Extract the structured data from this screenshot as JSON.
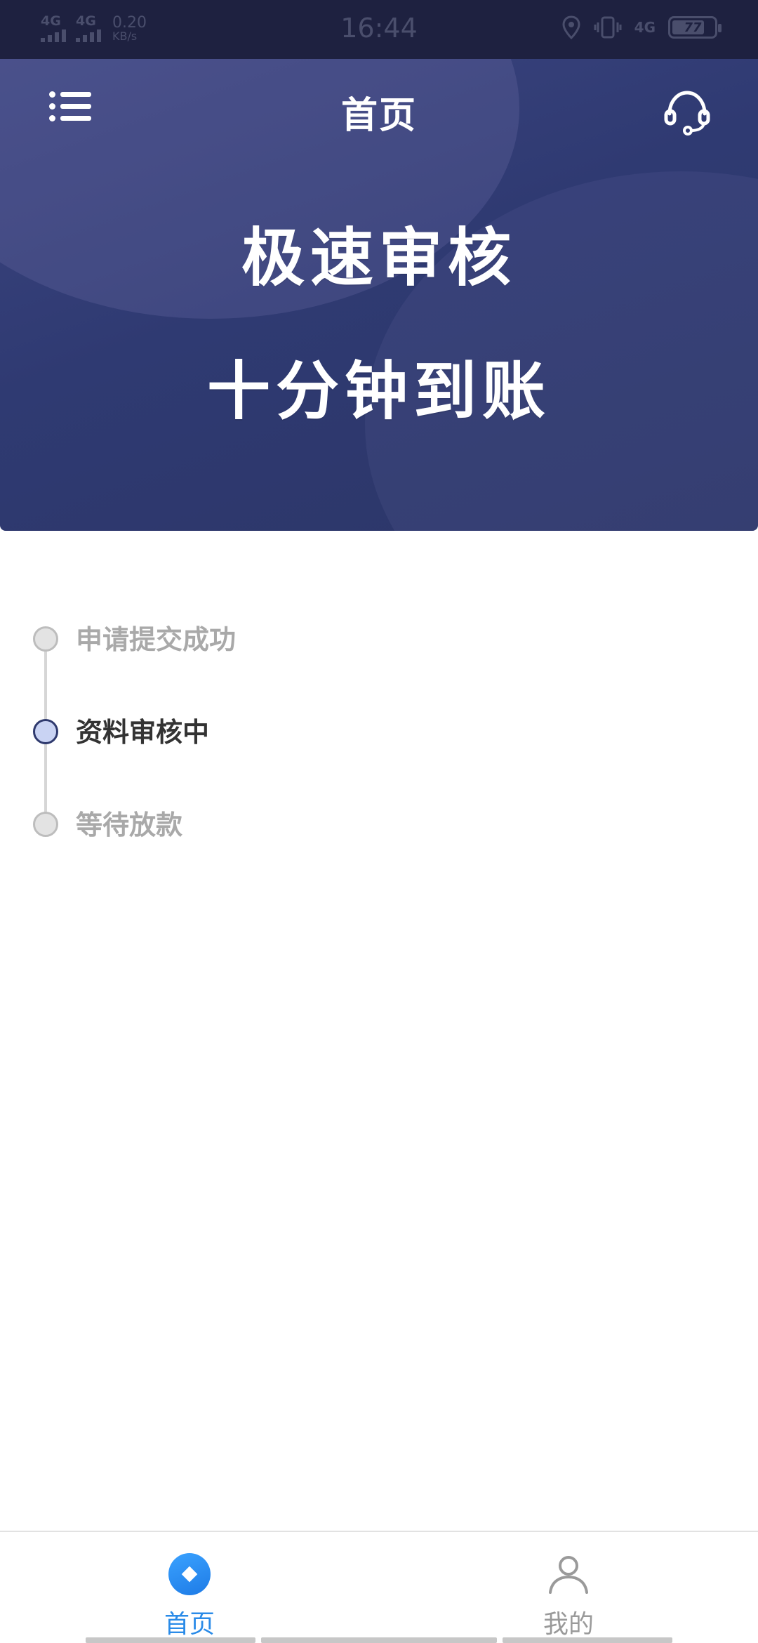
{
  "status_bar": {
    "signal_1": "4G",
    "signal_2": "4G",
    "speed_value": "0.20",
    "speed_unit": "KB/s",
    "time": "16:44",
    "network": "4G",
    "battery": "77",
    "battery_level": 0.77
  },
  "header": {
    "title": "首页",
    "menu_icon": "menu-list-icon",
    "support_icon": "headset-icon"
  },
  "hero": {
    "line1": "极速审核",
    "line2": "十分钟到账"
  },
  "timeline": {
    "steps": [
      {
        "label": "申请提交成功",
        "state": "done"
      },
      {
        "label": "资料审核中",
        "state": "active"
      },
      {
        "label": "等待放款",
        "state": "pending"
      }
    ]
  },
  "bottom_nav": {
    "items": [
      {
        "label": "首页",
        "icon": "home-diamond-icon",
        "active": true
      },
      {
        "label": "我的",
        "icon": "user-icon",
        "active": false
      }
    ]
  },
  "colors": {
    "hero_bg": "#2f3a72",
    "status_bar_bg": "#1e2140",
    "accent": "#2a8be8",
    "step_active": "#c9d3f3"
  }
}
